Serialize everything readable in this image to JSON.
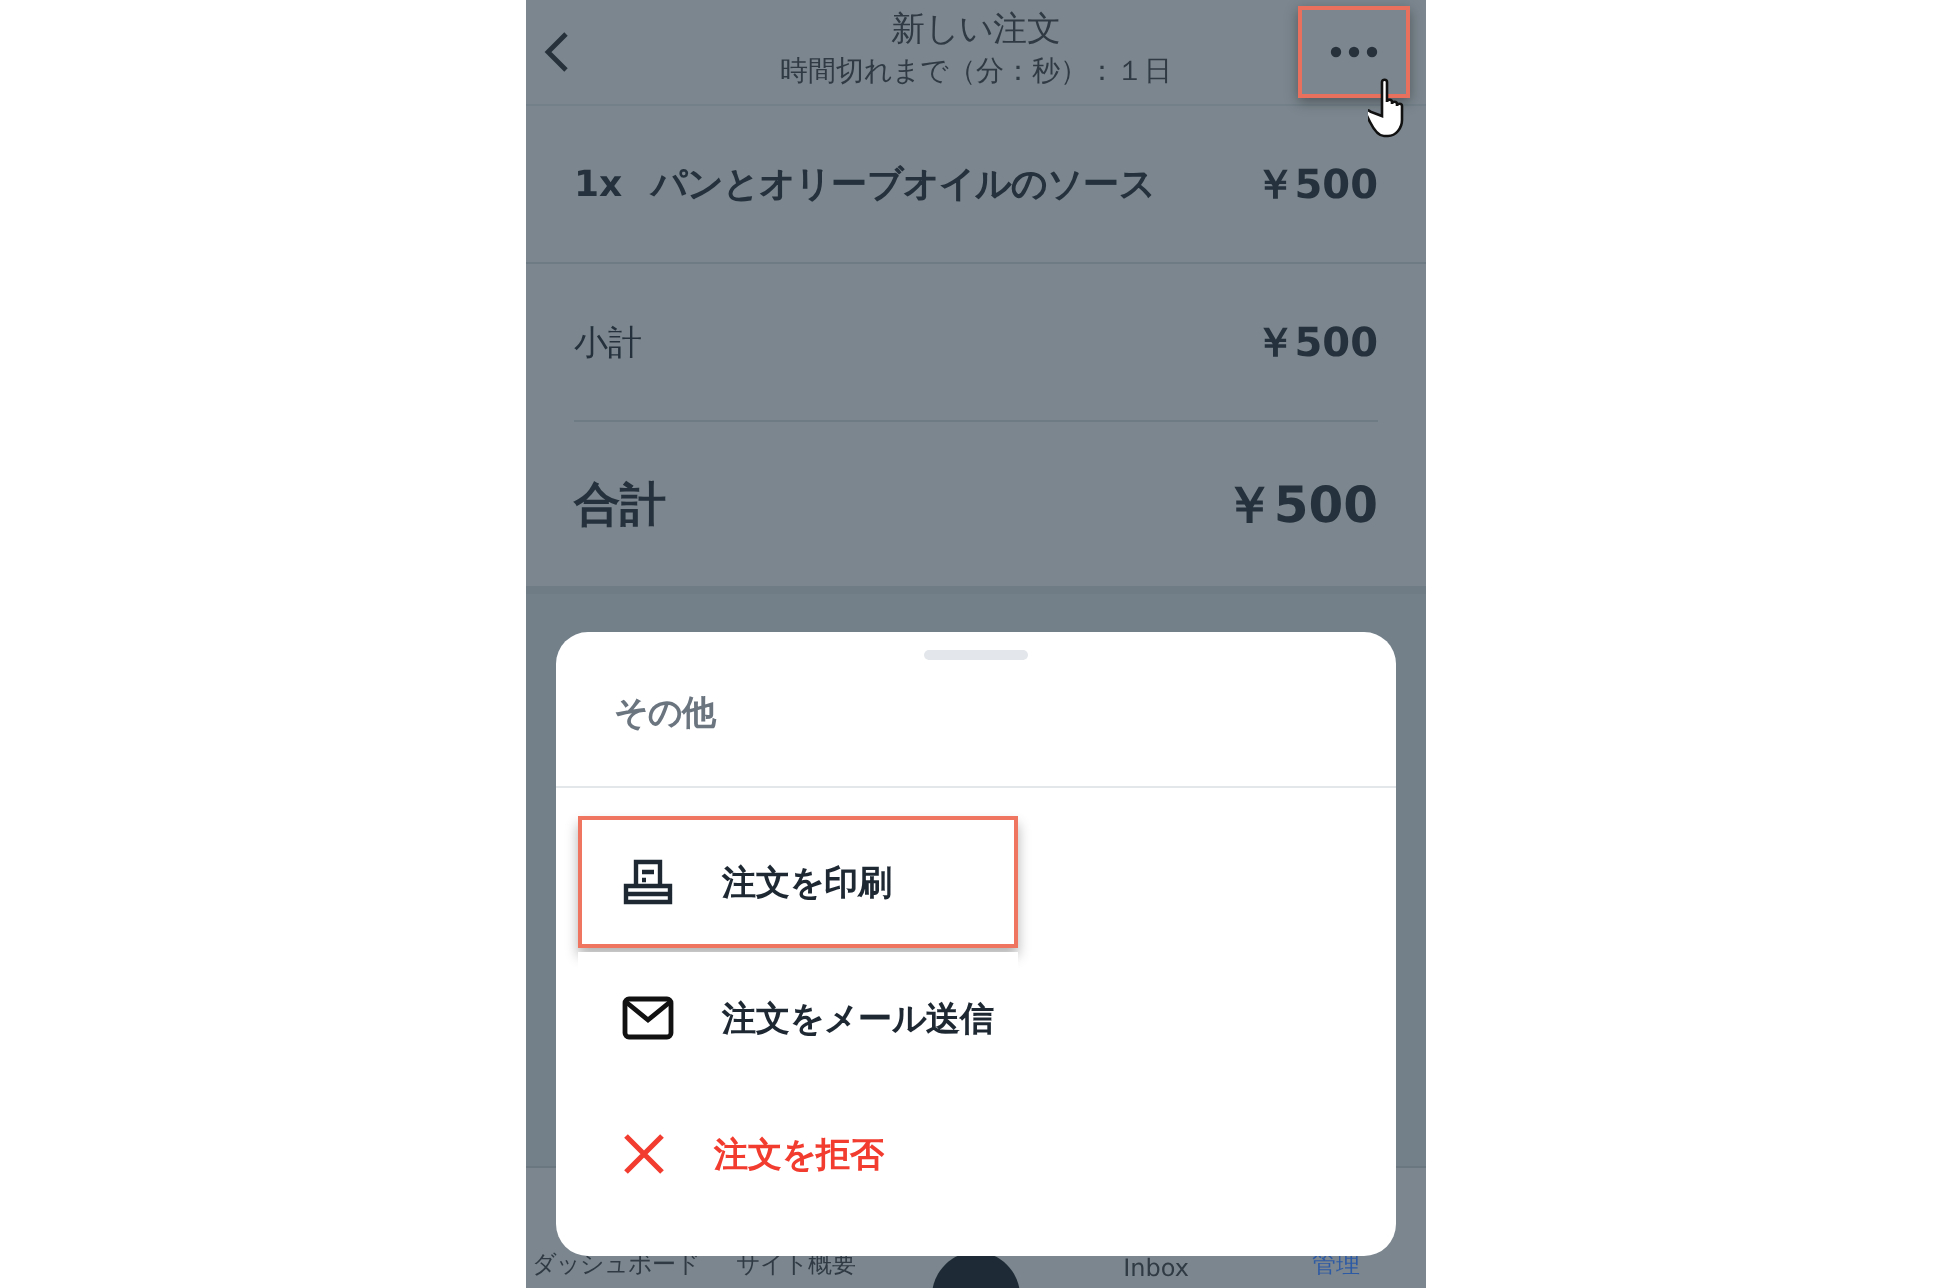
{
  "header": {
    "title": "新しい注文",
    "subtitle": "時間切れまで（分：秒）：１日",
    "more_highlighted": true
  },
  "order_items": [
    {
      "quantity": "1x",
      "name": "パンとオリーブオイルのソース",
      "price": "￥500"
    }
  ],
  "subtotal": {
    "label": "小計",
    "value": "￥500"
  },
  "total": {
    "label": "合計",
    "value": "￥500"
  },
  "tab_bar": [
    {
      "label": "ダッシュボード",
      "selected": false
    },
    {
      "label": "サイト概要",
      "selected": false
    },
    {
      "label": "Inbox",
      "selected": false
    },
    {
      "label": "管理",
      "selected": true
    }
  ],
  "sheet": {
    "title": "その他",
    "actions": [
      {
        "label": "注文を印刷",
        "kind": "print",
        "highlighted": true
      },
      {
        "label": "注文をメール送信",
        "kind": "email",
        "highlighted": false
      },
      {
        "label": "注文を拒否",
        "kind": "reject",
        "highlighted": false
      }
    ]
  }
}
